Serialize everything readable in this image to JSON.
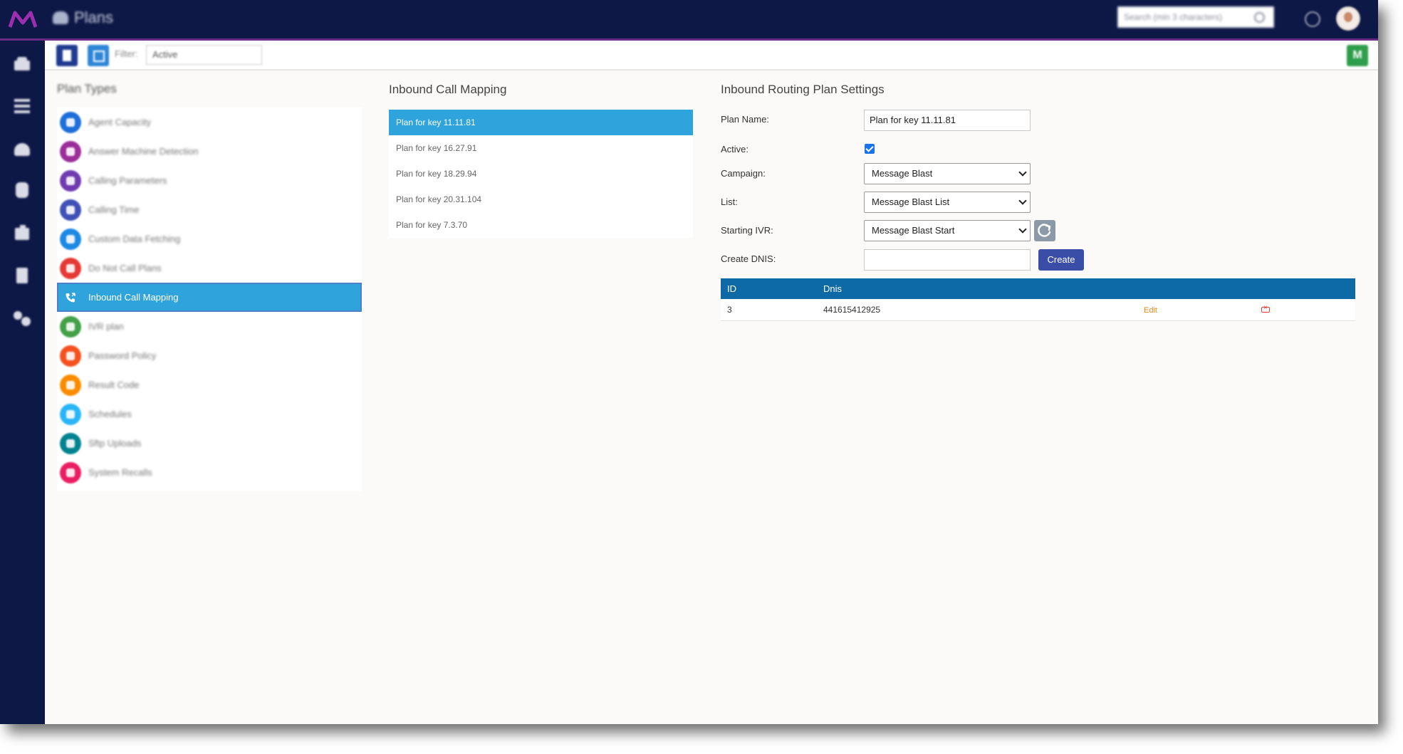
{
  "header": {
    "app_title": "Plans",
    "search_placeholder": "Search (min 3 characters)"
  },
  "toolbar": {
    "filter_label": "Filter:",
    "filter_value": "Active",
    "right_badge": "M"
  },
  "plan_types": {
    "title": "Plan Types",
    "items": [
      {
        "label": "Agent Capacity",
        "color": "#1e6fd9"
      },
      {
        "label": "Answer Machine Detection",
        "color": "#9c2e9a"
      },
      {
        "label": "Calling Parameters",
        "color": "#6f3bb0"
      },
      {
        "label": "Calling Time",
        "color": "#3f51b5"
      },
      {
        "label": "Custom Data Fetching",
        "color": "#1e88e5"
      },
      {
        "label": "Do Not Call Plans",
        "color": "#e53935"
      },
      {
        "label": "Inbound Call Mapping",
        "color": "#2fa3dc"
      },
      {
        "label": "IVR plan",
        "color": "#43a047"
      },
      {
        "label": "Password Policy",
        "color": "#f4511e"
      },
      {
        "label": "Result Code",
        "color": "#fb8c00"
      },
      {
        "label": "Schedules",
        "color": "#29b6f6"
      },
      {
        "label": "Sftp Uploads",
        "color": "#00838f"
      },
      {
        "label": "System Recalls",
        "color": "#e91e63"
      }
    ]
  },
  "inbound_mapping": {
    "title": "Inbound Call Mapping",
    "plans": [
      "Plan for key 11.11.81",
      "Plan for key 16.27.91",
      "Plan for key 18.29.94",
      "Plan for key 20.31.104",
      "Plan for key 7.3.70"
    ]
  },
  "settings": {
    "title": "Inbound Routing Plan Settings",
    "plan_name_label": "Plan Name:",
    "plan_name_value": "Plan for key 11.11.81",
    "active_label": "Active:",
    "active_checked": true,
    "campaign_label": "Campaign:",
    "campaign_value": "Message Blast",
    "list_label": "List:",
    "list_value": "Message Blast List",
    "ivr_label": "Starting IVR:",
    "ivr_value": "Message Blast Start",
    "dnis_label": "Create DNIS:",
    "dnis_value": "",
    "create_label": "Create"
  },
  "dnis_table": {
    "headers": [
      "ID",
      "Dnis"
    ],
    "rows": [
      {
        "id": "3",
        "dnis": "441615412925",
        "edit": "Edit"
      }
    ]
  },
  "colors": {
    "topbar": "#0e1846",
    "accent": "#2fa3dc",
    "table_header": "#0e6aa6",
    "create_button": "#3a4ea8"
  }
}
